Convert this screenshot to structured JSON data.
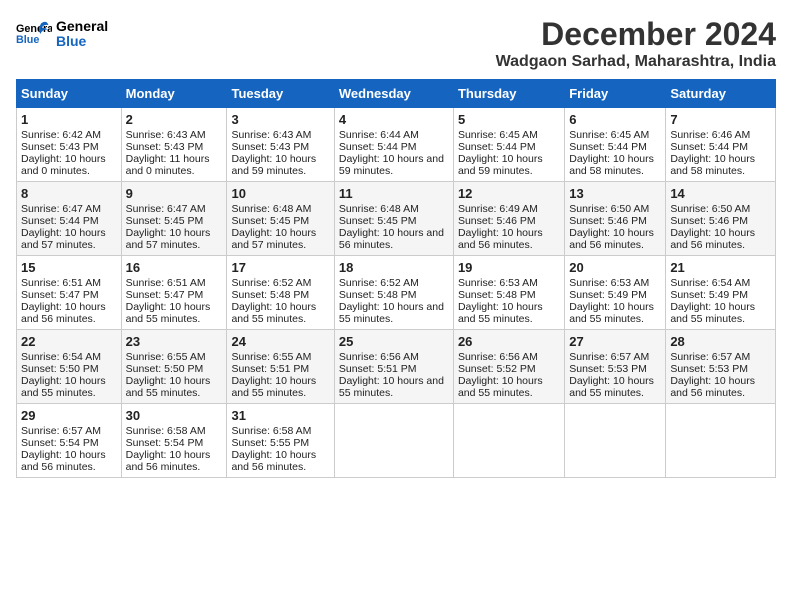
{
  "logo": {
    "line1": "General",
    "line2": "Blue"
  },
  "title": "December 2024",
  "location": "Wadgaon Sarhad, Maharashtra, India",
  "days_of_week": [
    "Sunday",
    "Monday",
    "Tuesday",
    "Wednesday",
    "Thursday",
    "Friday",
    "Saturday"
  ],
  "weeks": [
    [
      {
        "day": 1,
        "sunrise": "6:42 AM",
        "sunset": "5:43 PM",
        "daylight": "10 hours and 0 minutes"
      },
      {
        "day": 2,
        "sunrise": "6:43 AM",
        "sunset": "5:43 PM",
        "daylight": "11 hours and 0 minutes"
      },
      {
        "day": 3,
        "sunrise": "6:43 AM",
        "sunset": "5:43 PM",
        "daylight": "10 hours and 59 minutes"
      },
      {
        "day": 4,
        "sunrise": "6:44 AM",
        "sunset": "5:44 PM",
        "daylight": "10 hours and 59 minutes"
      },
      {
        "day": 5,
        "sunrise": "6:45 AM",
        "sunset": "5:44 PM",
        "daylight": "10 hours and 59 minutes"
      },
      {
        "day": 6,
        "sunrise": "6:45 AM",
        "sunset": "5:44 PM",
        "daylight": "10 hours and 58 minutes"
      },
      {
        "day": 7,
        "sunrise": "6:46 AM",
        "sunset": "5:44 PM",
        "daylight": "10 hours and 58 minutes"
      }
    ],
    [
      {
        "day": 8,
        "sunrise": "6:47 AM",
        "sunset": "5:44 PM",
        "daylight": "10 hours and 57 minutes"
      },
      {
        "day": 9,
        "sunrise": "6:47 AM",
        "sunset": "5:45 PM",
        "daylight": "10 hours and 57 minutes"
      },
      {
        "day": 10,
        "sunrise": "6:48 AM",
        "sunset": "5:45 PM",
        "daylight": "10 hours and 57 minutes"
      },
      {
        "day": 11,
        "sunrise": "6:48 AM",
        "sunset": "5:45 PM",
        "daylight": "10 hours and 56 minutes"
      },
      {
        "day": 12,
        "sunrise": "6:49 AM",
        "sunset": "5:46 PM",
        "daylight": "10 hours and 56 minutes"
      },
      {
        "day": 13,
        "sunrise": "6:50 AM",
        "sunset": "5:46 PM",
        "daylight": "10 hours and 56 minutes"
      },
      {
        "day": 14,
        "sunrise": "6:50 AM",
        "sunset": "5:46 PM",
        "daylight": "10 hours and 56 minutes"
      }
    ],
    [
      {
        "day": 15,
        "sunrise": "6:51 AM",
        "sunset": "5:47 PM",
        "daylight": "10 hours and 56 minutes"
      },
      {
        "day": 16,
        "sunrise": "6:51 AM",
        "sunset": "5:47 PM",
        "daylight": "10 hours and 55 minutes"
      },
      {
        "day": 17,
        "sunrise": "6:52 AM",
        "sunset": "5:48 PM",
        "daylight": "10 hours and 55 minutes"
      },
      {
        "day": 18,
        "sunrise": "6:52 AM",
        "sunset": "5:48 PM",
        "daylight": "10 hours and 55 minutes"
      },
      {
        "day": 19,
        "sunrise": "6:53 AM",
        "sunset": "5:48 PM",
        "daylight": "10 hours and 55 minutes"
      },
      {
        "day": 20,
        "sunrise": "6:53 AM",
        "sunset": "5:49 PM",
        "daylight": "10 hours and 55 minutes"
      },
      {
        "day": 21,
        "sunrise": "6:54 AM",
        "sunset": "5:49 PM",
        "daylight": "10 hours and 55 minutes"
      }
    ],
    [
      {
        "day": 22,
        "sunrise": "6:54 AM",
        "sunset": "5:50 PM",
        "daylight": "10 hours and 55 minutes"
      },
      {
        "day": 23,
        "sunrise": "6:55 AM",
        "sunset": "5:50 PM",
        "daylight": "10 hours and 55 minutes"
      },
      {
        "day": 24,
        "sunrise": "6:55 AM",
        "sunset": "5:51 PM",
        "daylight": "10 hours and 55 minutes"
      },
      {
        "day": 25,
        "sunrise": "6:56 AM",
        "sunset": "5:51 PM",
        "daylight": "10 hours and 55 minutes"
      },
      {
        "day": 26,
        "sunrise": "6:56 AM",
        "sunset": "5:52 PM",
        "daylight": "10 hours and 55 minutes"
      },
      {
        "day": 27,
        "sunrise": "6:57 AM",
        "sunset": "5:53 PM",
        "daylight": "10 hours and 55 minutes"
      },
      {
        "day": 28,
        "sunrise": "6:57 AM",
        "sunset": "5:53 PM",
        "daylight": "10 hours and 56 minutes"
      }
    ],
    [
      {
        "day": 29,
        "sunrise": "6:57 AM",
        "sunset": "5:54 PM",
        "daylight": "10 hours and 56 minutes"
      },
      {
        "day": 30,
        "sunrise": "6:58 AM",
        "sunset": "5:54 PM",
        "daylight": "10 hours and 56 minutes"
      },
      {
        "day": 31,
        "sunrise": "6:58 AM",
        "sunset": "5:55 PM",
        "daylight": "10 hours and 56 minutes"
      },
      null,
      null,
      null,
      null
    ]
  ],
  "labels": {
    "sunrise": "Sunrise:",
    "sunset": "Sunset:",
    "daylight": "Daylight:"
  }
}
